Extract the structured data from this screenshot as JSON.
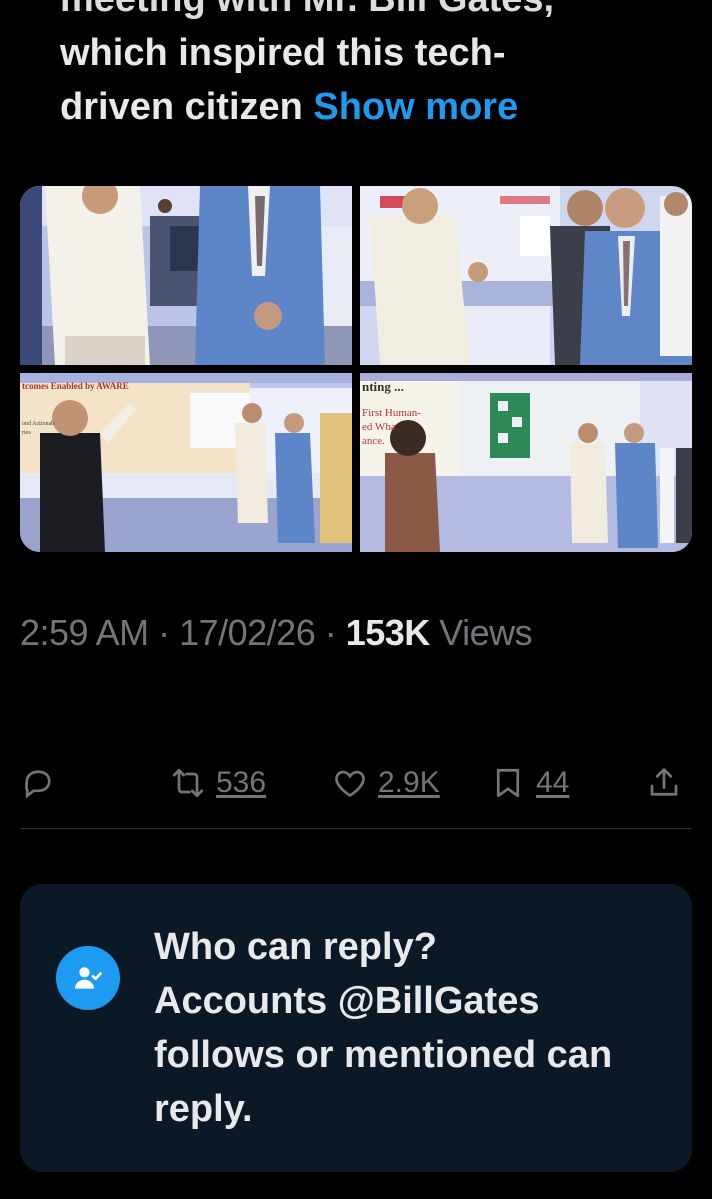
{
  "tweet": {
    "text_cut_line": "meeting with Mr. Bill Gates,",
    "text_line_2": "which inspired this tech-",
    "text_line_3": "driven citizen",
    "show_more_label": "Show more"
  },
  "photo_text": {
    "photo3_banner": "tcomes Enabled by AWARE",
    "photo3_side": "ond Actionab",
    "photo3_side2": "ries",
    "photo4_line1": "nting ...",
    "photo4_line2": "First Human-",
    "photo4_line3": "ed Wha",
    "photo4_line4": "ance."
  },
  "meta": {
    "time": "2:59 AM",
    "sep1": " · ",
    "date": "17/02/26",
    "sep2": " · ",
    "views_count": "153K",
    "views_label": " Views"
  },
  "actions": {
    "reposts": "536",
    "likes": "2.9K",
    "bookmarks": "44"
  },
  "reply_settings": {
    "heading": "Who can reply?",
    "body": "Accounts @BillGates follows or mentioned can reply."
  },
  "colors": {
    "background": "#000000",
    "accent": "#1d9bf0",
    "muted": "#71767b",
    "text": "#e7e9ea",
    "card": "#0b1826"
  },
  "icons": [
    "reply-icon",
    "repost-icon",
    "like-icon",
    "bookmark-icon",
    "share-icon",
    "person-check-icon"
  ]
}
